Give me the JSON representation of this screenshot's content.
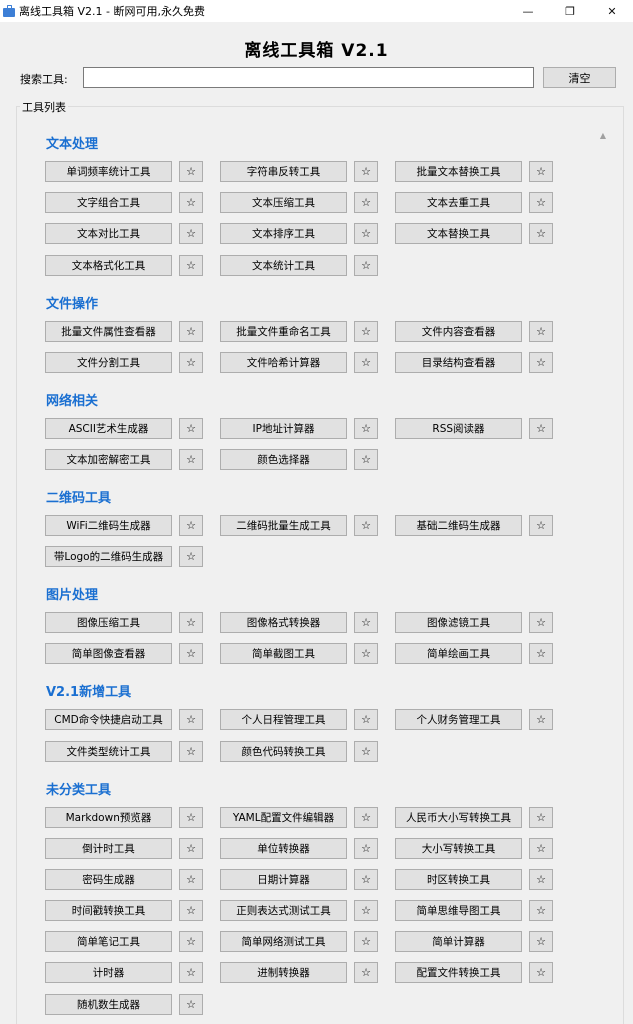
{
  "window": {
    "title": "离线工具箱 V2.1 - 断网可用,永久免费",
    "minimize": "—",
    "maximize": "❐",
    "close": "✕"
  },
  "app_title": "离线工具箱 V2.1",
  "search": {
    "label": "搜索工具:",
    "value": "",
    "clear_label": "清空"
  },
  "group_label": "工具列表",
  "star_glyph": "☆",
  "categories": [
    {
      "name": "文本处理",
      "tools": [
        "单词频率统计工具",
        "字符串反转工具",
        "批量文本替换工具",
        "文字组合工具",
        "文本压缩工具",
        "文本去重工具",
        "文本对比工具",
        "文本排序工具",
        "文本替换工具",
        "文本格式化工具",
        "文本统计工具"
      ]
    },
    {
      "name": "文件操作",
      "tools": [
        "批量文件属性查看器",
        "批量文件重命名工具",
        "文件内容查看器",
        "文件分割工具",
        "文件哈希计算器",
        "目录结构查看器"
      ]
    },
    {
      "name": "网络相关",
      "tools": [
        "ASCII艺术生成器",
        "IP地址计算器",
        "RSS阅读器",
        "文本加密解密工具",
        "颜色选择器"
      ]
    },
    {
      "name": "二维码工具",
      "tools": [
        "WiFi二维码生成器",
        "二维码批量生成工具",
        "基础二维码生成器",
        "带Logo的二维码生成器"
      ]
    },
    {
      "name": "图片处理",
      "tools": [
        "图像压缩工具",
        "图像格式转换器",
        "图像滤镜工具",
        "简单图像查看器",
        "简单截图工具",
        "简单绘画工具"
      ]
    },
    {
      "name": "V2.1新增工具",
      "tools": [
        "CMD命令快捷启动工具",
        "个人日程管理工具",
        "个人财务管理工具",
        "文件类型统计工具",
        "颜色代码转换工具"
      ]
    },
    {
      "name": "未分类工具",
      "tools": [
        "Markdown预览器",
        "YAML配置文件编辑器",
        "人民币大小写转换工具",
        "倒计时工具",
        "单位转换器",
        "大小写转换工具",
        "密码生成器",
        "日期计算器",
        "时区转换工具",
        "时间戳转换工具",
        "正则表达式测试工具",
        "简单思维导图工具",
        "简单笔记工具",
        "简单网络测试工具",
        "简单计算器",
        "计时器",
        "进制转换器",
        "配置文件转换工具",
        "随机数生成器"
      ]
    }
  ]
}
